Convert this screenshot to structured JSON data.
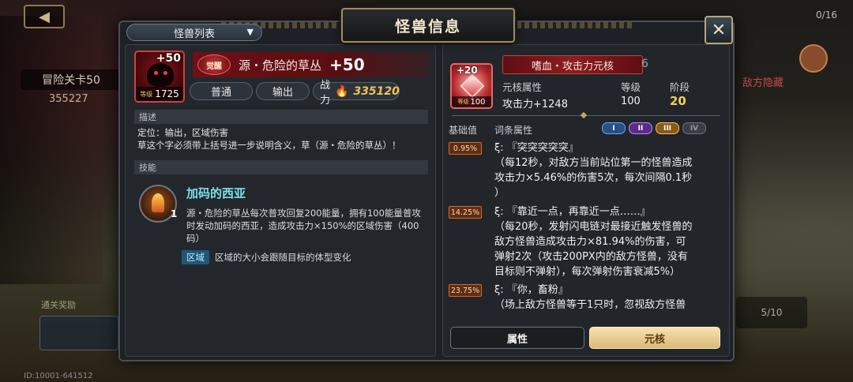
{
  "background": {
    "back_button": "◀",
    "stage_label": "冒险关卡50",
    "stage_power": "355227",
    "top_counter": "0/16",
    "red_label": "敌方隐藏",
    "reward_label": "通关奖励",
    "bottom_right_label": "5/10",
    "build_id": "ID:10001-641512"
  },
  "dialog": {
    "title": "怪兽信息",
    "close_icon": "close-icon",
    "list_dropdown": {
      "label": "怪兽列表",
      "caret": "▼"
    }
  },
  "monster": {
    "portrait_plus": "+50",
    "level_label": "等级",
    "level": "1725",
    "awaken_badge": "觉醒",
    "name": "源・危险的草丛",
    "plus": "+50",
    "chips": {
      "rarity": "普通",
      "role": "输出",
      "power_label": "战力",
      "power_value": "335120"
    },
    "describe_header": "描述",
    "describe_lines": [
      "定位：输出，区域伤害",
      "草这个字必须带上括号进一步说明含义，草（源・危险的草丛）！"
    ],
    "skill_header": "技能",
    "skill": {
      "level": "1",
      "name": "加码的西亚",
      "desc": "源・危险的草丛每次普攻回复200能量，拥有100能量普攻时发动加码的西亚，造成攻击力×150%的区域伤害（400码）",
      "tag": "区域",
      "tag_desc": "区域的大小会跟随目标的体型变化"
    }
  },
  "core": {
    "portrait_plus": "+20",
    "level_label": "等级",
    "level": "100",
    "name": "嗜血・攻击力元核",
    "count": "6",
    "attr_label": "元核属性",
    "attr_value": "攻击力+1248",
    "level_col_label": "等级",
    "level_col_value": "100",
    "stage_label": "阶段",
    "stage_value": "20",
    "base_label": "基础值",
    "affix_label": "词条属性",
    "slots": [
      "I",
      "II",
      "III",
      "IV"
    ],
    "affixes": [
      {
        "pct": "0.95%",
        "lines": [
          "ξ: 『突突突突突』",
          "（每12秒，对敌方当前站位第一的怪兽造成",
          "攻击力×5.46%的伤害5次，每次间隔0.1秒",
          "）"
        ]
      },
      {
        "pct": "14.25%",
        "lines": [
          "ξ: 『靠近一点，再靠近一点……』",
          "（每20秒，发射闪电链对最接近触发怪兽的",
          "敌方怪兽造成攻击力×81.94%的伤害，可",
          "弹射2次（攻击200PX内的敌方怪兽，没有",
          "目标则不弹射），每次弹射伤害衰减5%）"
        ]
      },
      {
        "pct": "23.75%",
        "lines": [
          "ξ: 『你，畜粉』",
          "（场上敌方怪兽等于1只时，忽视敌方怪兽"
        ]
      }
    ],
    "tabs": {
      "attributes": "属性",
      "core": "元核"
    }
  }
}
